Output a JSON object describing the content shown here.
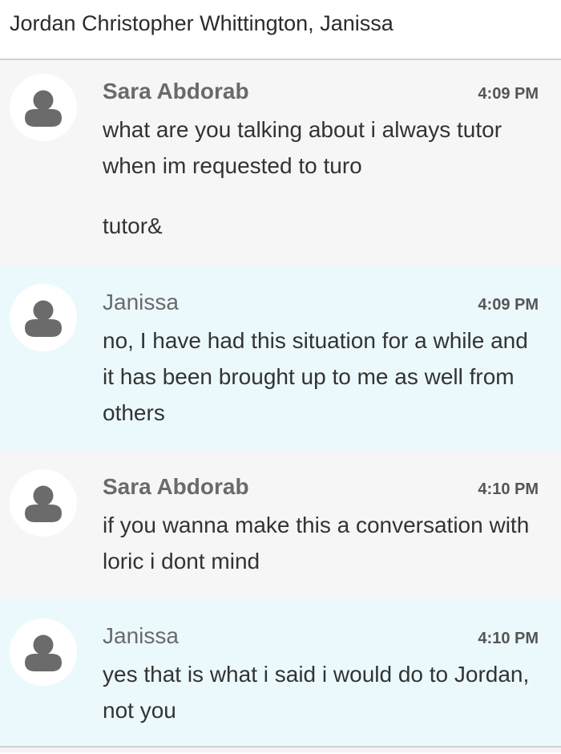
{
  "header": {
    "title": "Jordan Christopher Whittington, Janissa"
  },
  "messages": [
    {
      "sender": "Sara Abdorab",
      "time": "4:09 PM",
      "paragraphs": [
        "what are you talking about i always tutor when im requested to turo",
        "tutor&"
      ]
    },
    {
      "sender": "Janissa",
      "time": "4:09 PM",
      "paragraphs": [
        "no, I have had this situation for a while and it has been brought up to me as well from others"
      ]
    },
    {
      "sender": "Sara Abdorab",
      "time": "4:10 PM",
      "paragraphs": [
        "if you wanna make this a conversation with loric i dont mind"
      ]
    },
    {
      "sender": "Janissa",
      "time": "4:10 PM",
      "paragraphs": [
        "yes that is what i said i would do to Jordan, not you"
      ]
    }
  ],
  "icons": {
    "avatar": "person-silhouette-icon"
  },
  "colors": {
    "other_bg": "#f6f6f6",
    "self_bg": "#ebf9fd",
    "avatar_silhouette": "#6b6b6b"
  }
}
